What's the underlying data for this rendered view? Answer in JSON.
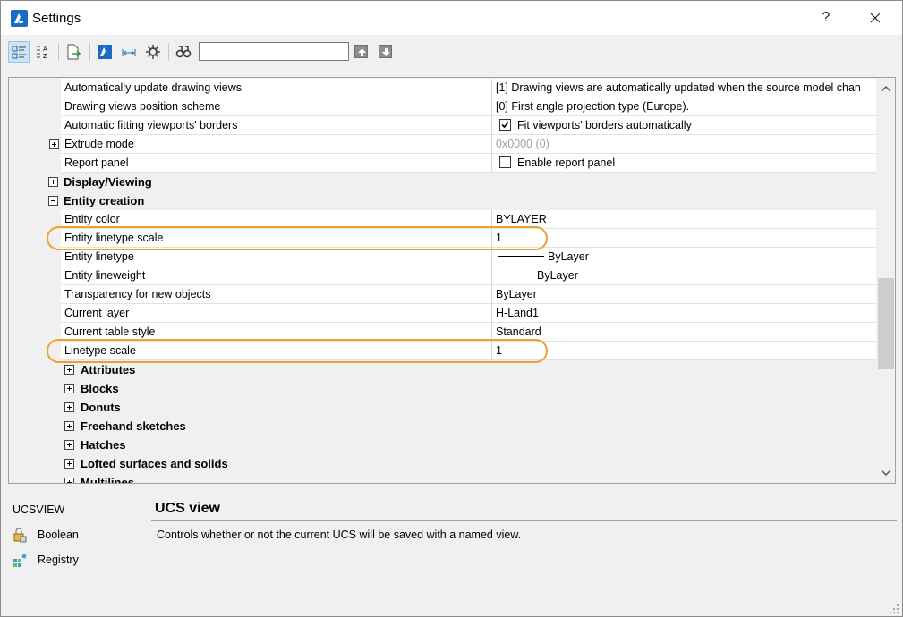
{
  "window": {
    "title": "Settings",
    "help_label": "?"
  },
  "toolbar": {
    "search_value": ""
  },
  "rows": [
    {
      "kind": "prop",
      "name": "Automatically update drawing views",
      "value": "[1] Drawing views are automatically updated when the source model chan"
    },
    {
      "kind": "prop",
      "name": "Drawing views position scheme",
      "value": "[0] First angle projection type (Europe)."
    },
    {
      "kind": "prop",
      "name": "Automatic fitting viewports' borders",
      "value": "Fit viewports' borders automatically",
      "checkbox": true
    },
    {
      "kind": "prop",
      "name": "Extrude mode",
      "value": "0x0000 (0)",
      "expander": "plus",
      "disabled": true
    },
    {
      "kind": "prop",
      "name": "Report panel",
      "value": "Enable report panel",
      "checkbox": false
    },
    {
      "kind": "group",
      "level": 1,
      "name": "Display/Viewing",
      "expander": "plus"
    },
    {
      "kind": "group",
      "level": 1,
      "name": "Entity creation",
      "expander": "minus"
    },
    {
      "kind": "prop",
      "name": "Entity color",
      "value": "BYLAYER"
    },
    {
      "kind": "prop",
      "name": "Entity linetype scale",
      "value": "1"
    },
    {
      "kind": "prop",
      "name": "Entity linetype",
      "value": "ByLayer",
      "line": "linetype"
    },
    {
      "kind": "prop",
      "name": "Entity lineweight",
      "value": "ByLayer",
      "line": "lineweight"
    },
    {
      "kind": "prop",
      "name": "Transparency for new objects",
      "value": "ByLayer"
    },
    {
      "kind": "prop",
      "name": "Current layer",
      "value": "H-Land1"
    },
    {
      "kind": "prop",
      "name": "Current table style",
      "value": "Standard"
    },
    {
      "kind": "prop",
      "name": "Linetype scale",
      "value": "1"
    },
    {
      "kind": "group",
      "level": 2,
      "name": "Attributes",
      "expander": "plus"
    },
    {
      "kind": "group",
      "level": 2,
      "name": "Blocks",
      "expander": "plus"
    },
    {
      "kind": "group",
      "level": 2,
      "name": "Donuts",
      "expander": "plus"
    },
    {
      "kind": "group",
      "level": 2,
      "name": "Freehand sketches",
      "expander": "plus"
    },
    {
      "kind": "group",
      "level": 2,
      "name": "Hatches",
      "expander": "plus"
    },
    {
      "kind": "group",
      "level": 2,
      "name": "Lofted surfaces and solids",
      "expander": "plus"
    },
    {
      "kind": "group",
      "level": 2,
      "name": "Multilines",
      "expander": "plus"
    }
  ],
  "highlight_color": "#f0a030",
  "bottom": {
    "command_name": "UCSVIEW",
    "type_label": "Boolean",
    "storage_label": "Registry",
    "description_title": "UCS view",
    "description_text": "Controls whether or not the current UCS will be saved with a named view."
  }
}
